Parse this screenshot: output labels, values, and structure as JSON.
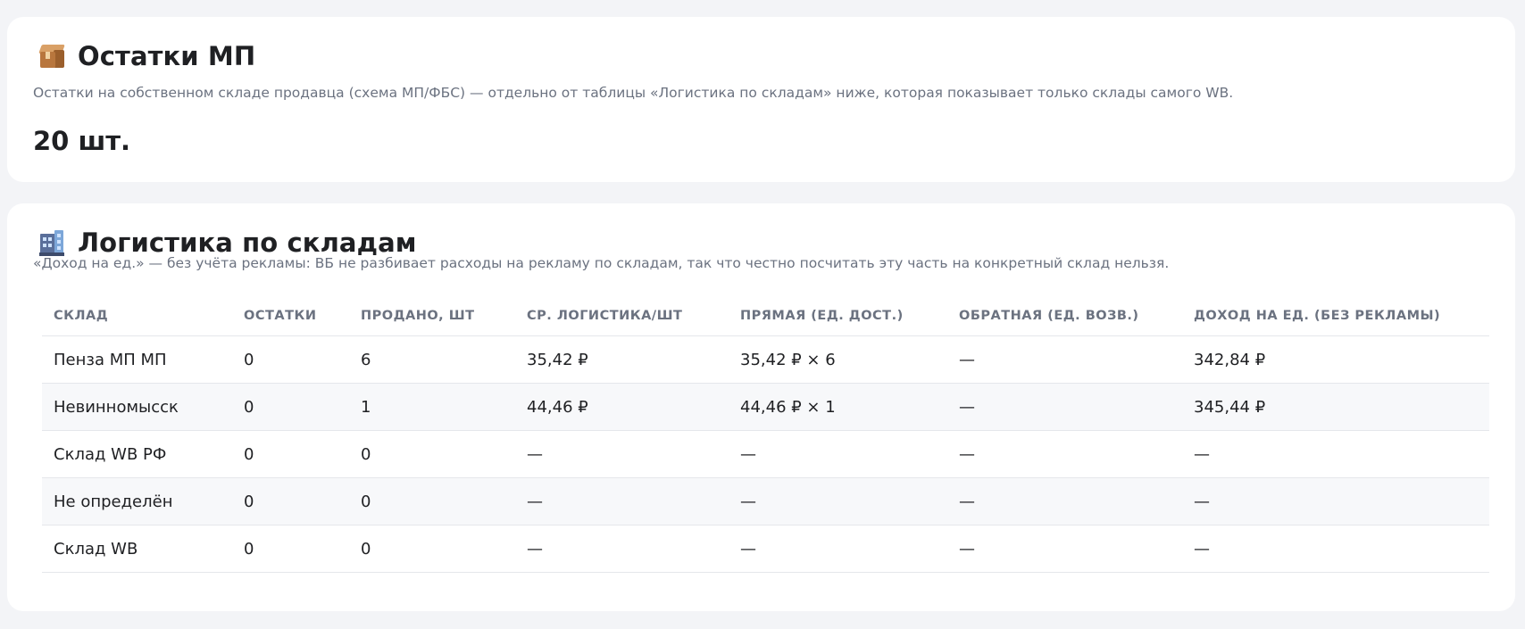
{
  "stock_card": {
    "icon": "package-icon",
    "title": "Остатки МП",
    "description": "Остатки на собственном складе продавца (схема МП/ФБС) — отдельно от таблицы «Логистика по складам» ниже, которая показывает только склады самого WB.",
    "value": "20 шт."
  },
  "logistics_card": {
    "icon": "office-building-icon",
    "title": "Логистика по складам",
    "description": "«Доход на ед.» — без учёта рекламы: ВБ не разбивает расходы на рекламу по складам, так что честно посчитать эту часть на конкретный склад нельзя.",
    "columns": [
      "СКЛАД",
      "ОСТАТКИ",
      "ПРОДАНО, ШТ",
      "СР. ЛОГИСТИКА/ШТ",
      "ПРЯМАЯ (ЕД. ДОСТ.)",
      "ОБРАТНАЯ (ЕД. ВОЗВ.)",
      "ДОХОД НА ЕД. (БЕЗ РЕКЛАМЫ)"
    ],
    "rows": [
      [
        "Пенза МП МП",
        "0",
        "6",
        "35,42 ₽",
        "35,42 ₽ × 6",
        "—",
        "342,84 ₽"
      ],
      [
        "Невинномысск",
        "0",
        "1",
        "44,46 ₽",
        "44,46 ₽ × 1",
        "—",
        "345,44 ₽"
      ],
      [
        "Склад WB РФ",
        "0",
        "0",
        "—",
        "—",
        "—",
        "—"
      ],
      [
        "Не определён",
        "0",
        "0",
        "—",
        "—",
        "—",
        "—"
      ],
      [
        "Склад WB",
        "0",
        "0",
        "—",
        "—",
        "—",
        "—"
      ]
    ]
  }
}
